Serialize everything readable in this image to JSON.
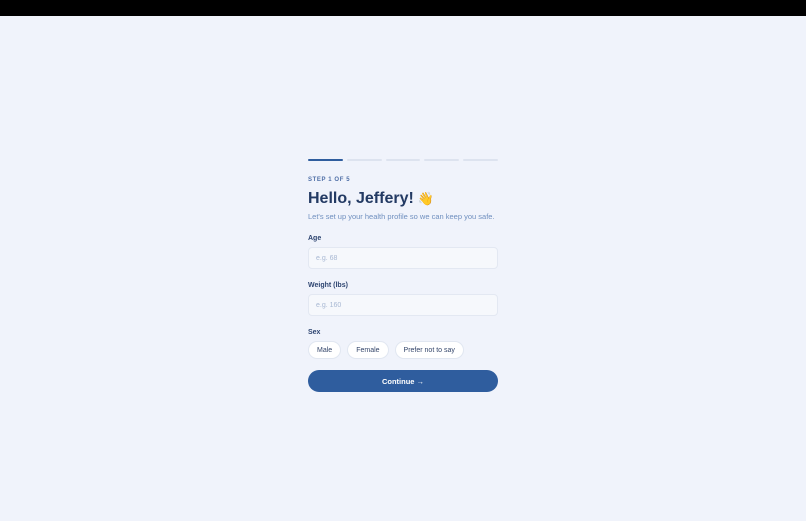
{
  "progress": {
    "total_steps": 5,
    "current_step": 1
  },
  "header": {
    "step_label": "STEP 1 OF 5",
    "title": "Hello, Jeffery!",
    "title_emoji": "👋",
    "subtitle": "Let's set up your health profile so we can keep you safe."
  },
  "form": {
    "age": {
      "label": "Age",
      "placeholder": "e.g. 68",
      "value": ""
    },
    "weight": {
      "label": "Weight (lbs)",
      "placeholder": "e.g. 160",
      "value": ""
    },
    "sex": {
      "label": "Sex",
      "options": [
        "Male",
        "Female",
        "Prefer not to say"
      ]
    },
    "continue_label": "Continue →"
  },
  "colors": {
    "accent": "#2f5d9e",
    "background": "#f0f3fb",
    "heading": "#233a63"
  }
}
